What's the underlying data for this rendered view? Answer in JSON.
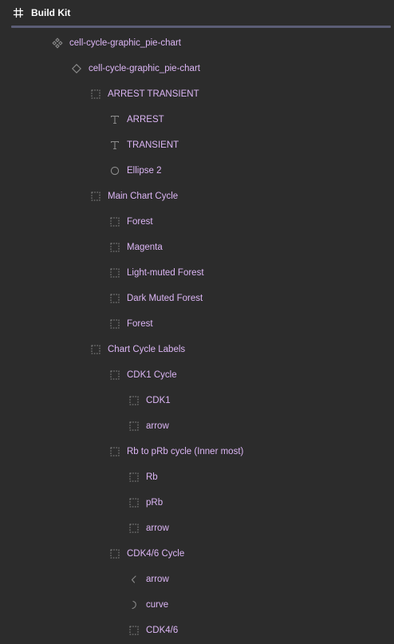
{
  "panel": {
    "title": "Build Kit",
    "title_icon": "frame-hash-icon"
  },
  "colors": {
    "background": "#2c2c2c",
    "label": "#dcb6f5",
    "icon": "#8c8c8c",
    "title": "#ffffff",
    "divider": "#5b5d75"
  },
  "layers": [
    {
      "label": "cell-cycle-graphic_pie-chart",
      "icon": "component-icon",
      "depth": 0
    },
    {
      "label": "cell-cycle-graphic_pie-chart",
      "icon": "instance-icon",
      "depth": 1
    },
    {
      "label": "ARREST TRANSIENT",
      "icon": "group-icon",
      "depth": 2
    },
    {
      "label": "ARREST",
      "icon": "text-icon",
      "depth": 3
    },
    {
      "label": "TRANSIENT",
      "icon": "text-icon",
      "depth": 3
    },
    {
      "label": "Ellipse 2",
      "icon": "ellipse-icon",
      "depth": 3
    },
    {
      "label": "Main Chart Cycle",
      "icon": "group-icon",
      "depth": 2
    },
    {
      "label": "Forest",
      "icon": "group-icon",
      "depth": 3
    },
    {
      "label": "Magenta",
      "icon": "group-icon",
      "depth": 3
    },
    {
      "label": "Light-muted Forest",
      "icon": "group-icon",
      "depth": 3
    },
    {
      "label": "Dark Muted Forest",
      "icon": "group-icon",
      "depth": 3
    },
    {
      "label": "Forest",
      "icon": "group-icon",
      "depth": 3
    },
    {
      "label": "Chart Cycle Labels",
      "icon": "group-icon",
      "depth": 2
    },
    {
      "label": "CDK1 Cycle",
      "icon": "group-icon",
      "depth": 3
    },
    {
      "label": "CDK1",
      "icon": "group-icon",
      "depth": 4
    },
    {
      "label": "arrow",
      "icon": "group-icon",
      "depth": 4
    },
    {
      "label": "Rb to pRb cycle (Inner most)",
      "icon": "group-icon",
      "depth": 3
    },
    {
      "label": "Rb",
      "icon": "group-icon",
      "depth": 4
    },
    {
      "label": "pRb",
      "icon": "group-icon",
      "depth": 4
    },
    {
      "label": "arrow",
      "icon": "group-icon",
      "depth": 4
    },
    {
      "label": "CDK4/6 Cycle",
      "icon": "group-icon",
      "depth": 3
    },
    {
      "label": "arrow",
      "icon": "arrow-vector-icon",
      "depth": 4
    },
    {
      "label": "curve",
      "icon": "curve-vector-icon",
      "depth": 4
    },
    {
      "label": "CDK4/6",
      "icon": "group-icon",
      "depth": 4
    }
  ]
}
